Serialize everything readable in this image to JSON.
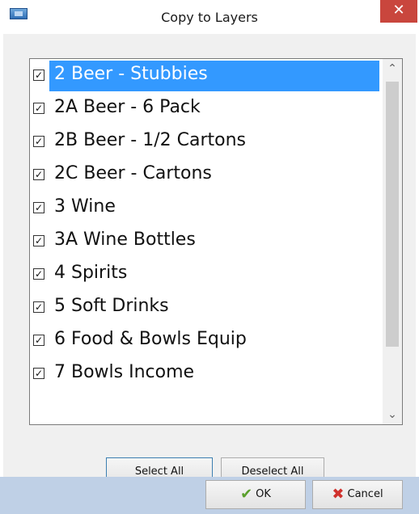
{
  "window": {
    "title": "Copy to Layers",
    "close_glyph": "✕"
  },
  "list": {
    "items": [
      {
        "label": "2 Beer - Stubbies",
        "checked": true,
        "selected": true
      },
      {
        "label": "2A Beer - 6 Pack",
        "checked": true,
        "selected": false
      },
      {
        "label": "2B Beer - 1/2 Cartons",
        "checked": true,
        "selected": false
      },
      {
        "label": "2C Beer - Cartons",
        "checked": true,
        "selected": false
      },
      {
        "label": "3 Wine",
        "checked": true,
        "selected": false
      },
      {
        "label": "3A Wine Bottles",
        "checked": true,
        "selected": false
      },
      {
        "label": "4 Spirits",
        "checked": true,
        "selected": false
      },
      {
        "label": "5 Soft Drinks",
        "checked": true,
        "selected": false
      },
      {
        "label": "6 Food & Bowls Equip",
        "checked": true,
        "selected": false
      },
      {
        "label": "7 Bowls Income",
        "checked": true,
        "selected": false
      }
    ],
    "check_glyph": "✓",
    "scroll_up_glyph": "⌃",
    "scroll_down_glyph": "⌄"
  },
  "buttons": {
    "select_all": "Select All",
    "deselect_all": "Deselect All",
    "ok": "OK",
    "cancel": "Cancel"
  },
  "icons": {
    "ok": "check-icon",
    "cancel": "x-icon"
  },
  "colors": {
    "selection": "#3399ff",
    "close_button": "#c9463d",
    "footer": "#bfd0e6",
    "ok_icon": "#5aa02c",
    "cancel_icon": "#d0312d"
  }
}
